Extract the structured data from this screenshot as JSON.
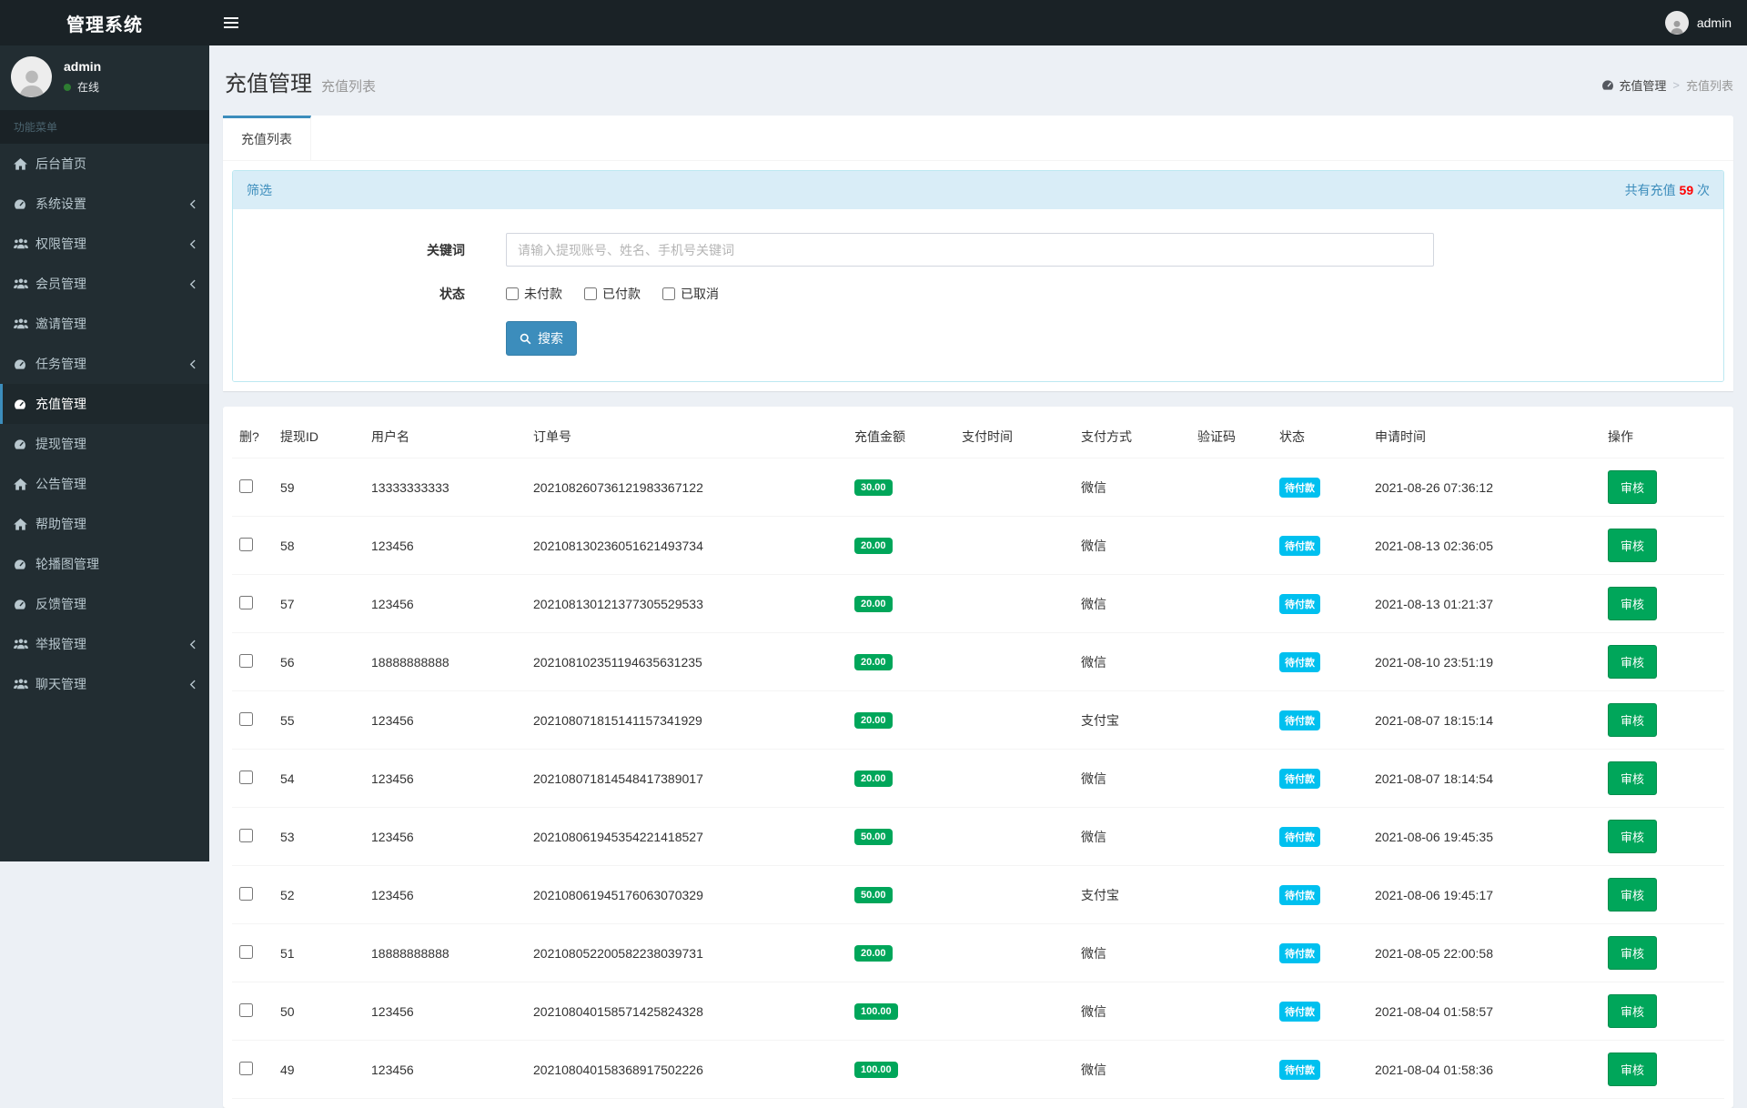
{
  "navbar": {
    "brand": "管理系统",
    "user": "admin"
  },
  "sidebar": {
    "user": {
      "name": "admin",
      "status": "在线"
    },
    "section_header": "功能菜单",
    "items": [
      {
        "label": "后台首页",
        "icon": "home",
        "arrow": false,
        "active": false
      },
      {
        "label": "系统设置",
        "icon": "gauge",
        "arrow": true,
        "active": false
      },
      {
        "label": "权限管理",
        "icon": "users",
        "arrow": true,
        "active": false
      },
      {
        "label": "会员管理",
        "icon": "users",
        "arrow": true,
        "active": false
      },
      {
        "label": "邀请管理",
        "icon": "users",
        "arrow": false,
        "active": false
      },
      {
        "label": "任务管理",
        "icon": "gauge",
        "arrow": true,
        "active": false
      },
      {
        "label": "充值管理",
        "icon": "gauge",
        "arrow": false,
        "active": true
      },
      {
        "label": "提现管理",
        "icon": "gauge",
        "arrow": false,
        "active": false
      },
      {
        "label": "公告管理",
        "icon": "home",
        "arrow": false,
        "active": false
      },
      {
        "label": "帮助管理",
        "icon": "home",
        "arrow": false,
        "active": false
      },
      {
        "label": "轮播图管理",
        "icon": "gauge",
        "arrow": false,
        "active": false
      },
      {
        "label": "反馈管理",
        "icon": "gauge",
        "arrow": false,
        "active": false
      },
      {
        "label": "举报管理",
        "icon": "users",
        "arrow": true,
        "active": false
      },
      {
        "label": "聊天管理",
        "icon": "users",
        "arrow": true,
        "active": false
      }
    ]
  },
  "header": {
    "title": "充值管理",
    "subtitle": "充值列表",
    "breadcrumb_main": "充值管理",
    "breadcrumb_sep": ">",
    "breadcrumb_active": "充值列表"
  },
  "tabs": [
    {
      "label": "充值列表",
      "active": true
    }
  ],
  "filter": {
    "title": "筛选",
    "total_prefix": "共有充值 ",
    "total_count": "59",
    "total_suffix": " 次",
    "keyword_label": "关键词",
    "keyword_placeholder": "请输入提现账号、姓名、手机号关键词",
    "keyword_value": "",
    "status_label": "状态",
    "status_options": [
      "未付款",
      "已付款",
      "已取消"
    ],
    "search_label": "搜索"
  },
  "table": {
    "columns": [
      "删?",
      "提现ID",
      "用户名",
      "订单号",
      "充值金额",
      "支付时间",
      "支付方式",
      "验证码",
      "状态",
      "申请时间",
      "操作"
    ],
    "rows": [
      {
        "id": "59",
        "username": "13333333333",
        "order_no": "202108260736121983367122",
        "amount": "30.00",
        "pay_time": "",
        "pay_method": "微信",
        "verify_code": "",
        "status": "待付款",
        "apply_time": "2021-08-26 07:36:12",
        "action": "审核"
      },
      {
        "id": "58",
        "username": "123456",
        "order_no": "202108130236051621493734",
        "amount": "20.00",
        "pay_time": "",
        "pay_method": "微信",
        "verify_code": "",
        "status": "待付款",
        "apply_time": "2021-08-13 02:36:05",
        "action": "审核"
      },
      {
        "id": "57",
        "username": "123456",
        "order_no": "202108130121377305529533",
        "amount": "20.00",
        "pay_time": "",
        "pay_method": "微信",
        "verify_code": "",
        "status": "待付款",
        "apply_time": "2021-08-13 01:21:37",
        "action": "审核"
      },
      {
        "id": "56",
        "username": "18888888888",
        "order_no": "202108102351194635631235",
        "amount": "20.00",
        "pay_time": "",
        "pay_method": "微信",
        "verify_code": "",
        "status": "待付款",
        "apply_time": "2021-08-10 23:51:19",
        "action": "审核"
      },
      {
        "id": "55",
        "username": "123456",
        "order_no": "202108071815141157341929",
        "amount": "20.00",
        "pay_time": "",
        "pay_method": "支付宝",
        "verify_code": "",
        "status": "待付款",
        "apply_time": "2021-08-07 18:15:14",
        "action": "审核"
      },
      {
        "id": "54",
        "username": "123456",
        "order_no": "202108071814548417389017",
        "amount": "20.00",
        "pay_time": "",
        "pay_method": "微信",
        "verify_code": "",
        "status": "待付款",
        "apply_time": "2021-08-07 18:14:54",
        "action": "审核"
      },
      {
        "id": "53",
        "username": "123456",
        "order_no": "202108061945354221418527",
        "amount": "50.00",
        "pay_time": "",
        "pay_method": "微信",
        "verify_code": "",
        "status": "待付款",
        "apply_time": "2021-08-06 19:45:35",
        "action": "审核"
      },
      {
        "id": "52",
        "username": "123456",
        "order_no": "202108061945176063070329",
        "amount": "50.00",
        "pay_time": "",
        "pay_method": "支付宝",
        "verify_code": "",
        "status": "待付款",
        "apply_time": "2021-08-06 19:45:17",
        "action": "审核"
      },
      {
        "id": "51",
        "username": "18888888888",
        "order_no": "202108052200582238039731",
        "amount": "20.00",
        "pay_time": "",
        "pay_method": "微信",
        "verify_code": "",
        "status": "待付款",
        "apply_time": "2021-08-05 22:00:58",
        "action": "审核"
      },
      {
        "id": "50",
        "username": "123456",
        "order_no": "202108040158571425824328",
        "amount": "100.00",
        "pay_time": "",
        "pay_method": "微信",
        "verify_code": "",
        "status": "待付款",
        "apply_time": "2021-08-04 01:58:57",
        "action": "审核"
      },
      {
        "id": "49",
        "username": "123456",
        "order_no": "202108040158368917502226",
        "amount": "100.00",
        "pay_time": "",
        "pay_method": "微信",
        "verify_code": "",
        "status": "待付款",
        "apply_time": "2021-08-04 01:58:36",
        "action": "审核"
      }
    ]
  },
  "colors": {
    "accent_blue": "#3c8dbc",
    "success_green": "#00a65a",
    "info_cyan": "#00c0ef",
    "count_red": "#ff0000",
    "navbar_dark": "#1a2226",
    "sidebar_dark": "#222d32"
  }
}
